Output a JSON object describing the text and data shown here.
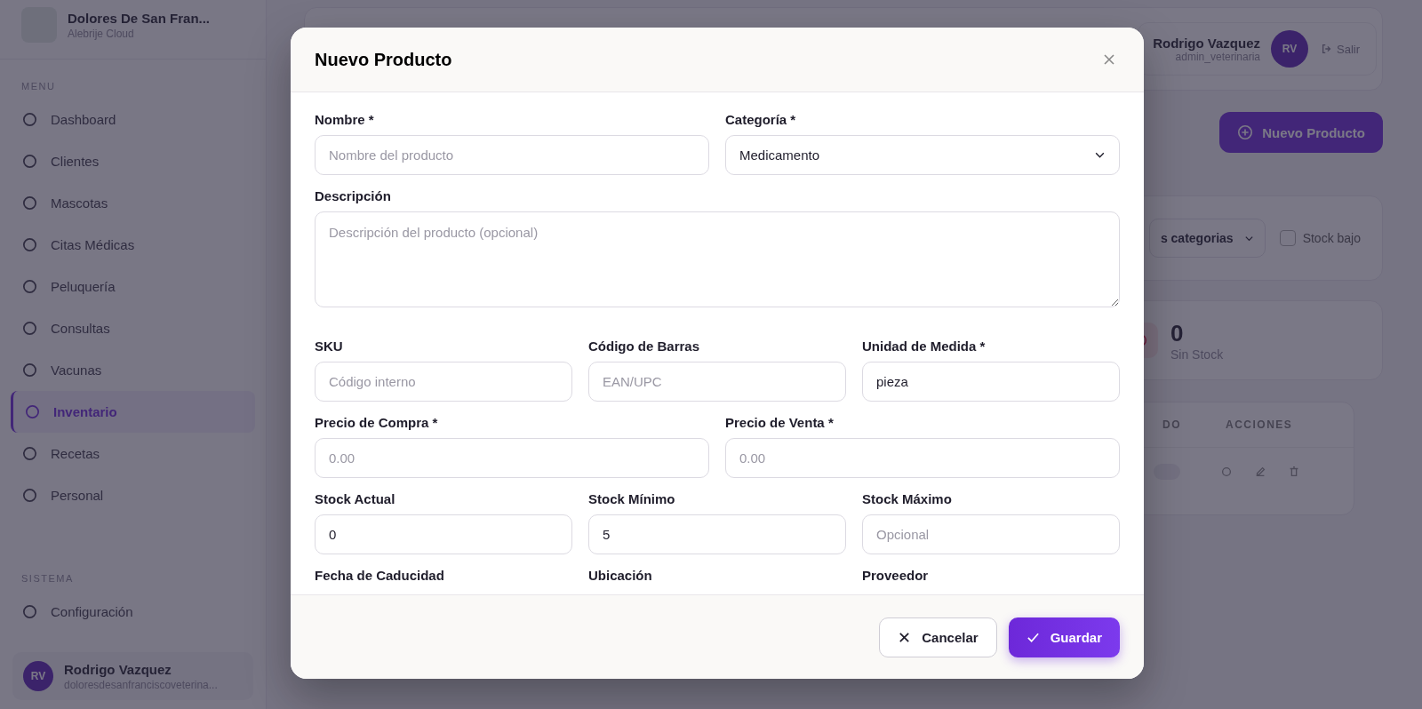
{
  "sidebar": {
    "clinic_name": "Dolores De San Fran...",
    "clinic_subtitle": "Alebrije Cloud",
    "sections": [
      {
        "title": "MENU",
        "items": [
          {
            "label": "Dashboard",
            "selected": false
          },
          {
            "label": "Clientes",
            "selected": false
          },
          {
            "label": "Mascotas",
            "selected": false
          },
          {
            "label": "Citas Médicas",
            "selected": false
          },
          {
            "label": "Peluquería",
            "selected": false
          },
          {
            "label": "Consultas",
            "selected": false
          },
          {
            "label": "Vacunas",
            "selected": false
          },
          {
            "label": "Inventario",
            "selected": true
          },
          {
            "label": "Recetas",
            "selected": false
          },
          {
            "label": "Personal",
            "selected": false
          }
        ]
      },
      {
        "title": "SISTEMA",
        "items": [
          {
            "label": "Configuración",
            "selected": false
          }
        ]
      }
    ],
    "user": {
      "initials": "RV",
      "name": "Rodrigo Vazquez",
      "email": "doloresdesanfranciscoveterina..."
    }
  },
  "header": {
    "user_name": "Rodrigo Vazquez",
    "user_role": "admin_veterinaria",
    "initials": "RV",
    "logout": "Salir"
  },
  "new_button": "Nuevo Producto",
  "filters": {
    "category": "s categorias",
    "low_stock": {
      "label": "Stock bajo",
      "checked": false
    }
  },
  "stat": {
    "value": "0",
    "label": "Sin Stock"
  },
  "table": {
    "columns": [
      "DO",
      "ACCIONES"
    ]
  },
  "modal": {
    "title": "Nuevo Producto",
    "rows": [
      [
        {
          "kind": "text",
          "label": "Nombre *",
          "placeholder": "Nombre del producto"
        },
        {
          "kind": "select",
          "label": "Categoría *",
          "value": "Medicamento"
        }
      ],
      [
        {
          "kind": "textarea",
          "label": "Descripción",
          "placeholder": "Descripción del producto (opcional)"
        }
      ],
      [
        {
          "kind": "text",
          "label": "SKU",
          "placeholder": "Código interno"
        },
        {
          "kind": "text",
          "label": "Código de Barras",
          "placeholder": "EAN/UPC"
        },
        {
          "kind": "text",
          "label": "Unidad de Medida *",
          "value": "pieza"
        }
      ],
      [
        {
          "kind": "text",
          "label": "Precio de Compra *",
          "placeholder": "0.00"
        },
        {
          "kind": "text",
          "label": "Precio de Venta *",
          "placeholder": "0.00"
        }
      ],
      [
        {
          "kind": "text",
          "label": "Stock Actual",
          "value": "0"
        },
        {
          "kind": "text",
          "label": "Stock Mínimo",
          "value": "5"
        },
        {
          "kind": "text",
          "label": "Stock Máximo",
          "placeholder": "Opcional"
        }
      ],
      [
        {
          "kind": "label",
          "label": "Fecha de Caducidad"
        },
        {
          "kind": "label",
          "label": "Ubicación"
        },
        {
          "kind": "label",
          "label": "Proveedor"
        }
      ]
    ],
    "cancel": "Cancelar",
    "save": "Guardar"
  }
}
